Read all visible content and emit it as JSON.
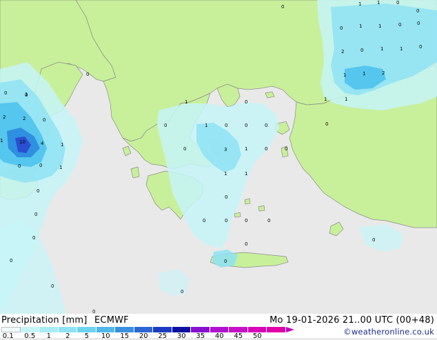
{
  "map": {
    "colors": {
      "sea": "#e9e9e9",
      "land": "#c8f09a",
      "coast": "#8a8a8a",
      "precip_light": "#c6f5f8",
      "precip_mid": "#8ee2f5",
      "precip_high": "#55c6ee",
      "precip_very_high": "#2f8fe0",
      "precip_core": "#2a4fd0"
    },
    "values": [
      "0",
      "1",
      "1",
      "0",
      "0",
      "0",
      "1",
      "0",
      "0",
      "1",
      "0",
      "2",
      "0",
      "1",
      "1",
      "1",
      "1",
      "2",
      "1",
      "1",
      "0",
      "1",
      "2",
      "2",
      "0",
      "1",
      "10",
      "4",
      "1",
      "0",
      "0",
      "1",
      "0",
      "0",
      "0",
      "0",
      "0",
      "1",
      "0",
      "0",
      "0",
      "0",
      "0",
      "0",
      "1",
      "3",
      "1",
      "0",
      "0",
      "0",
      "1",
      "1",
      "0",
      "0",
      "0",
      "0",
      "0",
      "0",
      "0",
      "0",
      "0",
      "0",
      "0",
      "0"
    ]
  },
  "footer": {
    "precip_label": "Precipitation [mm]",
    "model_label": "ECMWF",
    "valid_time": "Mo 19-01-2026 21..00 UTC (00+48)",
    "credit": "©weatheronline.co.uk"
  },
  "legend": {
    "ticks": [
      "0.1",
      "0.5",
      "1",
      "2",
      "5",
      "10",
      "15",
      "20",
      "25",
      "30",
      "35",
      "40",
      "45",
      "50"
    ],
    "colors": [
      "#f0fcfd",
      "#c6f5f8",
      "#a6ecf5",
      "#8ee2f5",
      "#6cd4f0",
      "#4fb8ec",
      "#3890e0",
      "#2a66d4",
      "#1a3cc0",
      "#0a10a0",
      "#8a10d0",
      "#b010d0",
      "#c810c8",
      "#d800b8",
      "#e000a8"
    ]
  }
}
